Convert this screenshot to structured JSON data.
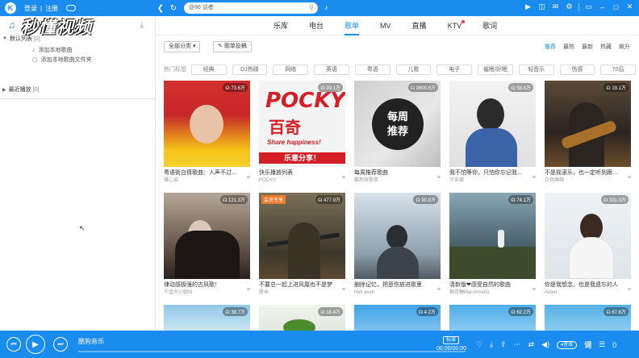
{
  "topbar": {
    "logo": "K",
    "login": "登录",
    "sep": "|",
    "register": "注册",
    "back_icon": "back-arrow-icon",
    "refresh_icon": "refresh-icon",
    "search_placeholder": "@86 谈者",
    "colors": {
      "primary": "#1a8cf0"
    }
  },
  "sidebar": {
    "brand": "秒懂视频",
    "default_list": {
      "label": "默认列表",
      "count": "[0]"
    },
    "links": [
      {
        "label": "添加本地歌曲"
      },
      {
        "label": "添加本地歌曲文件夹"
      }
    ],
    "recent": {
      "label": "最近播放",
      "count": "[0]"
    }
  },
  "tabs": [
    {
      "label": "乐库",
      "active": false
    },
    {
      "label": "电台",
      "active": false
    },
    {
      "label": "歌单",
      "active": true
    },
    {
      "label": "MV",
      "active": false
    },
    {
      "label": "直播",
      "active": false
    },
    {
      "label": "KTV",
      "active": false,
      "dot": true
    },
    {
      "label": "歌词",
      "active": false
    }
  ],
  "filters": {
    "category": "全部分类 ▾",
    "submit": "歌单投稿",
    "sort": [
      "推荐",
      "最热",
      "最新",
      "热藏",
      "飙升"
    ],
    "sort_active": "推荐",
    "hot_label": "热门标签",
    "hot_tags": [
      "经典",
      "DJ热碟",
      "网络",
      "英语",
      "粤语",
      "儿歌",
      "电子",
      "催眠/好眠",
      "轻音乐",
      "伤感",
      "70后"
    ]
  },
  "playlists": [
    {
      "title": "粤语街白情歌曲：人声不过戏一...",
      "author": "雅心谈",
      "plays": "73.6万"
    },
    {
      "title": "快乐播放列表",
      "author": "POCKY",
      "plays": "29.1万"
    },
    {
      "title": "每周推荐歌曲",
      "author": "酷狗官歌单",
      "plays": "3600.6万"
    },
    {
      "title": "我不怕等你，只怕你忘记我在等你",
      "author": "冷安娜",
      "plays": "58.6万"
    },
    {
      "title": "不是摇滚乐，也一定听到跟我的",
      "author": "白色绵绵",
      "plays": "19.1万"
    },
    {
      "title": "律动感极强的古风歌！",
      "author": "千金大小姐M",
      "plays": "121.3万"
    },
    {
      "title": "不要总一起上进风靡也不是梦",
      "author": "厘米",
      "plays": "477.9万",
      "vip": "会员专享"
    },
    {
      "title": "删除记忆，把悲伤放进歌里",
      "author": "Hell yeah",
      "plays": "90.8万"
    },
    {
      "title": "清新版❤感受自然的歌曲",
      "author": "棉花糖Marshmello",
      "plays": "74.1万"
    },
    {
      "title": "你是我想念，也是我遗忘的人",
      "author": "Aiden",
      "plays": "331.0万"
    },
    {
      "title": "",
      "author": "",
      "plays": "38.7万"
    },
    {
      "title": "",
      "author": "",
      "plays": "16.4万"
    },
    {
      "title": "",
      "author": "",
      "plays": "4.2万"
    },
    {
      "title": "",
      "author": "",
      "plays": "62.2万"
    },
    {
      "title": "",
      "author": "",
      "plays": "67.6万"
    }
  ],
  "cover_text": {
    "pocky_brand": "POCKY",
    "pocky_cn": "百奇",
    "pocky_en": "Share happiness!",
    "pocky_bar": "乐意分享！",
    "weekly_l1": "每周",
    "weekly_l2": "推荐"
  },
  "player": {
    "song": "酷狗音乐",
    "time": "00:00/00:00",
    "quality": "标准",
    "volume_pill": "♦音效",
    "lyric": "词",
    "count": "0"
  }
}
